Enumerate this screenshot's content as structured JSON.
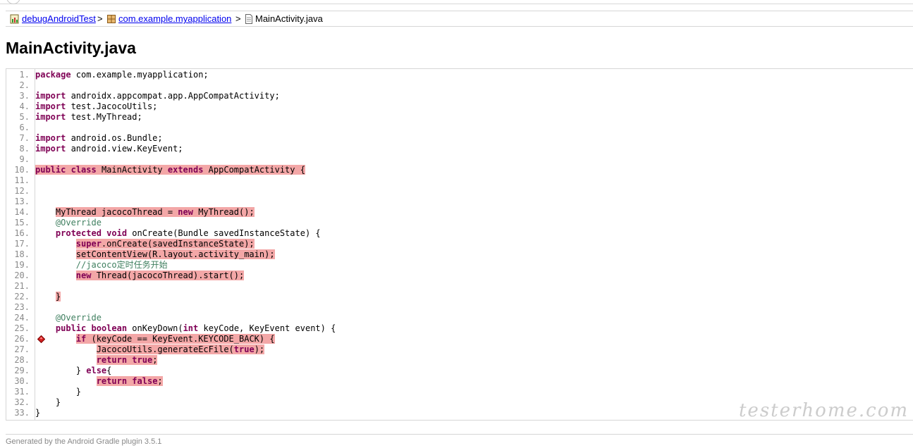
{
  "breadcrumb": {
    "items": [
      {
        "label": "debugAndroidTest",
        "icon": "report-icon"
      },
      {
        "label": "com.example.myapplication",
        "icon": "package-icon"
      }
    ],
    "separator": ">",
    "current": {
      "label": "MainActivity.java",
      "icon": "file-icon"
    }
  },
  "page_title": "MainActivity.java",
  "code": {
    "lines": [
      "package com.example.myapplication;",
      "",
      "import androidx.appcompat.app.AppCompatActivity;",
      "import test.JacocoUtils;",
      "import test.MyThread;",
      "",
      "import android.os.Bundle;",
      "import android.view.KeyEvent;",
      "",
      "public class MainActivity extends AppCompatActivity {",
      "",
      "",
      "",
      "    MyThread jacocoThread = new MyThread();",
      "    @Override",
      "    protected void onCreate(Bundle savedInstanceState) {",
      "        super.onCreate(savedInstanceState);",
      "        setContentView(R.layout.activity_main);",
      "        //jacoco定时任务开始",
      "        new Thread(jacocoThread).start();",
      "",
      "    }",
      "",
      "    @Override",
      "    public boolean onKeyDown(int keyCode, KeyEvent event) {",
      "        if (keyCode == KeyEvent.KEYCODE_BACK) {",
      "            JacocoUtils.generateEcFile(true);",
      "            return true;",
      "        } else{",
      "            return false;",
      "        }",
      "    }",
      "}"
    ],
    "not_covered_lines": [
      10,
      14,
      17,
      18,
      20,
      22,
      26,
      27,
      28,
      30
    ],
    "breakpoint_line": 26,
    "highlight_color": "#f3a7a7"
  },
  "footer": "Generated by the Android Gradle plugin 3.5.1",
  "watermark": "testerhome.com"
}
